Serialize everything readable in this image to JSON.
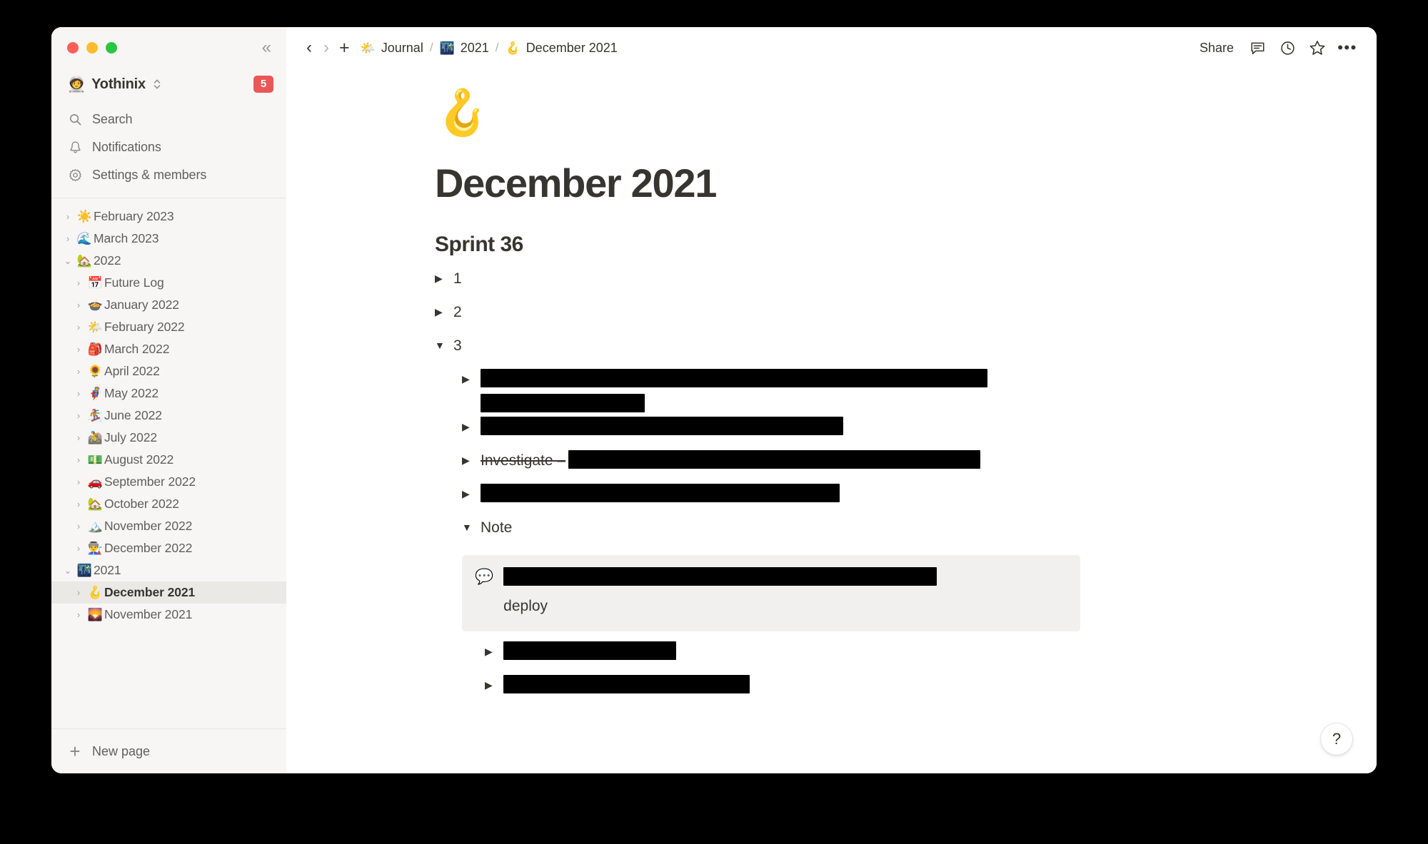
{
  "window": {
    "traffic_lights": [
      "close",
      "minimize",
      "zoom"
    ],
    "collapse_icon": "«"
  },
  "sidebar": {
    "workspace": {
      "emoji": "🧑‍🚀",
      "name": "Yothinix",
      "switcher_icon": "⌃⌄",
      "badge": "5"
    },
    "nav": [
      {
        "icon": "search-icon",
        "label": "Search"
      },
      {
        "icon": "bell-icon",
        "label": "Notifications"
      },
      {
        "icon": "gear-icon",
        "label": "Settings & members"
      }
    ],
    "tree": [
      {
        "arrow": "›",
        "emoji": "☀️",
        "label": "February 2023",
        "depth": 0,
        "expanded": false,
        "selected": false
      },
      {
        "arrow": "›",
        "emoji": "🌊",
        "label": "March 2023",
        "depth": 0,
        "expanded": false,
        "selected": false
      },
      {
        "arrow": "⌄",
        "emoji": "🏡",
        "label": "2022",
        "depth": 0,
        "expanded": true,
        "selected": false
      },
      {
        "arrow": "›",
        "emoji": "📅",
        "label": "Future Log",
        "depth": 1,
        "expanded": false,
        "selected": false
      },
      {
        "arrow": "›",
        "emoji": "🍲",
        "label": "January 2022",
        "depth": 1,
        "expanded": false,
        "selected": false
      },
      {
        "arrow": "›",
        "emoji": "🌤️",
        "label": "February 2022",
        "depth": 1,
        "expanded": false,
        "selected": false
      },
      {
        "arrow": "›",
        "emoji": "🎒",
        "label": "March 2022",
        "depth": 1,
        "expanded": false,
        "selected": false
      },
      {
        "arrow": "›",
        "emoji": "🌻",
        "label": "April 2022",
        "depth": 1,
        "expanded": false,
        "selected": false
      },
      {
        "arrow": "›",
        "emoji": "🦸",
        "label": "May 2022",
        "depth": 1,
        "expanded": false,
        "selected": false
      },
      {
        "arrow": "›",
        "emoji": "🏂",
        "label": "June 2022",
        "depth": 1,
        "expanded": false,
        "selected": false
      },
      {
        "arrow": "›",
        "emoji": "🚵",
        "label": "July 2022",
        "depth": 1,
        "expanded": false,
        "selected": false
      },
      {
        "arrow": "›",
        "emoji": "💵",
        "label": "August 2022",
        "depth": 1,
        "expanded": false,
        "selected": false
      },
      {
        "arrow": "›",
        "emoji": "🚗",
        "label": "September 2022",
        "depth": 1,
        "expanded": false,
        "selected": false
      },
      {
        "arrow": "›",
        "emoji": "🏡",
        "label": "October 2022",
        "depth": 1,
        "expanded": false,
        "selected": false
      },
      {
        "arrow": "›",
        "emoji": "🏔️",
        "label": "November 2022",
        "depth": 1,
        "expanded": false,
        "selected": false
      },
      {
        "arrow": "›",
        "emoji": "👨‍🏭",
        "label": "December 2022",
        "depth": 1,
        "expanded": false,
        "selected": false
      },
      {
        "arrow": "⌄",
        "emoji": "🌃",
        "label": "2021",
        "depth": 0,
        "expanded": true,
        "selected": false
      },
      {
        "arrow": "›",
        "emoji": "🪝",
        "label": "December 2021",
        "depth": 1,
        "expanded": false,
        "selected": true
      },
      {
        "arrow": "›",
        "emoji": "🌄",
        "label": "November 2021",
        "depth": 1,
        "expanded": false,
        "selected": false
      }
    ],
    "footer": {
      "icon": "plus-icon",
      "label": "New page"
    }
  },
  "topbar": {
    "back_icon": "‹",
    "forward_icon": "›",
    "plus_icon": "+",
    "breadcrumb": [
      {
        "emoji": "🌤️",
        "label": "Journal"
      },
      {
        "emoji": "🌃",
        "label": "2021"
      },
      {
        "emoji": "🪝",
        "label": "December 2021"
      }
    ],
    "separator": "/",
    "share_label": "Share",
    "actions": [
      {
        "icon": "comment-icon",
        "label": "Comments"
      },
      {
        "icon": "clock-icon",
        "label": "Updates"
      },
      {
        "icon": "star-icon",
        "label": "Favorite"
      },
      {
        "icon": "more-icon",
        "label": "More"
      }
    ]
  },
  "page": {
    "emoji": "🪝",
    "title": "December 2021",
    "heading": "Sprint 36",
    "toggles": [
      {
        "arrow": "▶",
        "label": "1",
        "expanded": false
      },
      {
        "arrow": "▶",
        "label": "2",
        "expanded": false
      },
      {
        "arrow": "▼",
        "label": "3",
        "expanded": true
      }
    ],
    "items": [
      {
        "arrow": "▶",
        "indent": 2,
        "type": "redacted-two-line",
        "redacted_widths": [
          710,
          230
        ],
        "label": ""
      },
      {
        "arrow": "▶",
        "indent": 2,
        "type": "redacted",
        "redacted_widths": [
          508
        ],
        "label": ""
      },
      {
        "arrow": "▶",
        "indent": 2,
        "type": "strike-redacted",
        "visible_text": "Investigate –",
        "redacted_widths": [
          577
        ],
        "label": "Investigate –"
      },
      {
        "arrow": "▶",
        "indent": 2,
        "type": "redacted",
        "redacted_widths": [
          503
        ],
        "label": ""
      }
    ],
    "note": {
      "arrow": "▼",
      "label": "Note",
      "expanded": true,
      "callout": {
        "icon": "💬",
        "redacted_width": 607,
        "text": "deploy"
      }
    },
    "trailing_items": [
      {
        "arrow": "▶",
        "indent": 3,
        "redacted_widths": [
          242
        ]
      },
      {
        "arrow": "▶",
        "indent": 3,
        "redacted_widths": [
          345
        ]
      }
    ]
  },
  "help": {
    "label": "?"
  }
}
